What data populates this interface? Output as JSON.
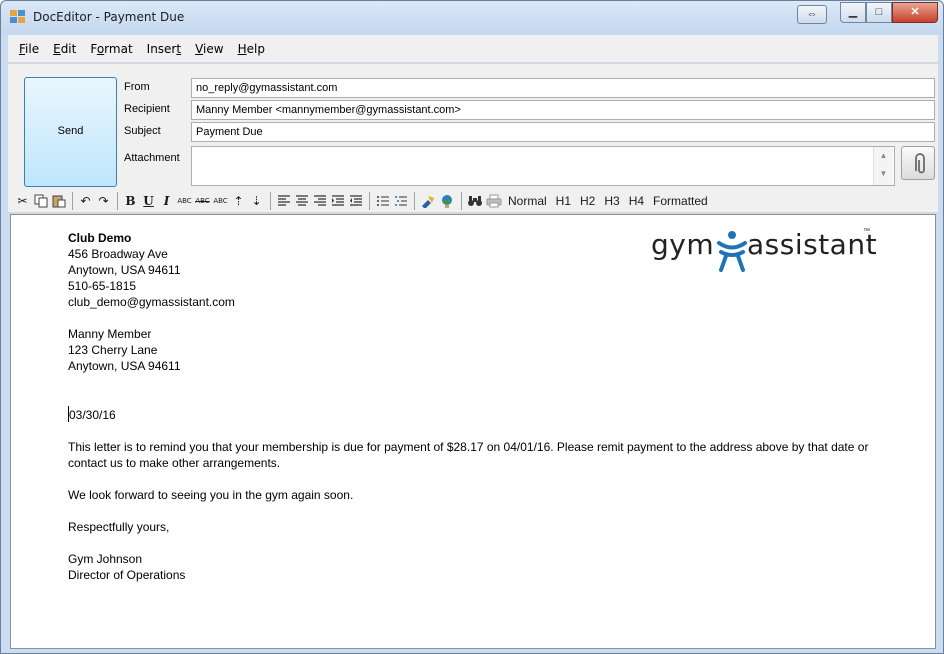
{
  "window": {
    "title": "DocEditor - Payment Due",
    "controls": {
      "restore_glyph": "⇔",
      "minimize_glyph": "▁",
      "maximize_glyph": "□",
      "close_glyph": "✕"
    }
  },
  "menu": {
    "items": [
      {
        "label": "File",
        "hotkey": "F",
        "rest": "ile"
      },
      {
        "label": "Edit",
        "hotkey": "E",
        "rest": "dit"
      },
      {
        "label": "Format",
        "pre": "F",
        "hotkey": "o",
        "rest": "rmat"
      },
      {
        "label": "Insert",
        "pre": "Inser",
        "hotkey": "t",
        "rest": ""
      },
      {
        "label": "View",
        "hotkey": "V",
        "rest": "iew"
      },
      {
        "label": "Help",
        "hotkey": "H",
        "rest": "elp"
      }
    ]
  },
  "compose": {
    "send_label": "Send",
    "from_label": "From",
    "from_value": "no_reply@gymassistant.com",
    "recipient_label": "Recipient",
    "recipient_value": "Manny Member <mannymember@gymassistant.com>",
    "subject_label": "Subject",
    "subject_value": "Payment Due",
    "attachment_label": "Attachment",
    "attachment_value": ""
  },
  "toolbar": {
    "style_buttons": [
      "Normal",
      "H1",
      "H2",
      "H3",
      "H4",
      "Formatted"
    ],
    "abc_labels": [
      "ABC",
      "ABC",
      "ABC"
    ]
  },
  "document": {
    "sender": {
      "name": "Club Demo",
      "address1": "456 Broadway Ave",
      "address2": "Anytown, USA 94611",
      "phone": "510-65-1815",
      "email": "club_demo@gymassistant.com"
    },
    "recipient": {
      "name": "Manny Member",
      "address1": "123 Cherry Lane",
      "address2": "Anytown, USA 94611"
    },
    "date": "03/30/16",
    "body1": "This letter is to remind you that your membership is due for payment of $28.17 on 04/01/16.  Please remit payment to the address above by that date or contact us to make other arrangements.",
    "body2": "We look forward to seeing you in the gym again soon.",
    "closing": "Respectfully yours,",
    "signer_name": "Gym Johnson",
    "signer_title": "Director of Operations"
  },
  "logo": {
    "left": "gym",
    "right": "assistant",
    "tm": "™"
  },
  "colors": {
    "logo_figure": "#1e73b8",
    "send_button_top": "#eaf6fd",
    "send_button_bottom": "#bee6fd",
    "close_button": "#c8412b"
  }
}
